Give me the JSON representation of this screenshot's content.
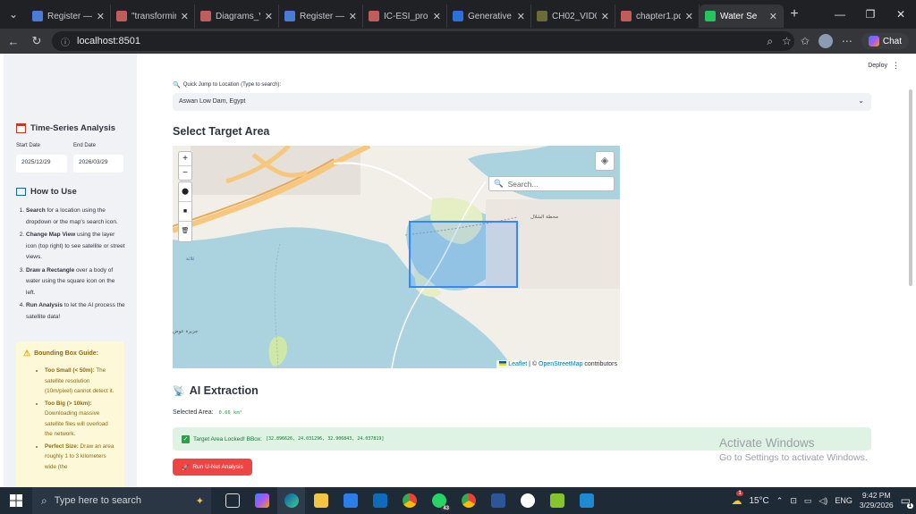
{
  "browser": {
    "tabs": [
      {
        "label": "Register — ",
        "color": "#4a7bd6"
      },
      {
        "label": "\"transformin",
        "color": "#c05c5c"
      },
      {
        "label": "Diagrams_V",
        "color": "#c05c5c"
      },
      {
        "label": "Register — ",
        "color": "#4a7bd6"
      },
      {
        "label": "IC-ESI_propo",
        "color": "#c05c5c"
      },
      {
        "label": "Generative ",
        "color": "#2a6fdb"
      },
      {
        "label": "CH02_VID01",
        "color": "#6b6b3a"
      },
      {
        "label": "chapter1.pdf",
        "color": "#c05c5c"
      },
      {
        "label": "Water Se",
        "color": "#22c55e"
      }
    ],
    "url": "localhost:8501",
    "chat_label": "Chat"
  },
  "sidebar": {
    "ts_title": "Time-Series Analysis",
    "start_label": "Start Date",
    "end_label": "End Date",
    "start_value": "2025/12/29",
    "end_value": "2026/03/29",
    "howto_title": "How to Use",
    "steps": [
      {
        "bold": "Search",
        "text": " for a location using the dropdown or the map's search icon."
      },
      {
        "bold": "Change Map View",
        "text": " using the layer icon (top right) to see satellite or street views."
      },
      {
        "bold": "Draw a Rectangle",
        "text": " over a body of water using the square icon on the left."
      },
      {
        "bold": "Run Analysis",
        "text": " to let the AI process the satellite data!"
      }
    ],
    "guide_title": "Bounding Box Guide:",
    "guide_items": [
      {
        "bold": "Too Small (< 50m):",
        "text": " The satellite resolution (10m/pixel) cannot detect it."
      },
      {
        "bold": "Too Big (> 10km):",
        "text": " Downloading massive satellite files will overload the network."
      },
      {
        "bold": "Perfect Size:",
        "text": " Draw an area roughly 1 to 3 kilometers wide (the"
      }
    ]
  },
  "main": {
    "deploy_label": "Deploy",
    "quick_jump_label": "Quick Jump to Location (Type to search):",
    "quick_jump_value": "Aswan Low Dam, Egypt",
    "select_title": "Select Target Area",
    "map": {
      "search_placeholder": "Search...",
      "attribution_leaflet": "Leaflet",
      "attribution_sep": " | © ",
      "attribution_osm": "OpenStreetMap",
      "attribution_tail": " contributors",
      "labels": [
        "محطة الشلال",
        "ثلاثة",
        "جزيرة عوض"
      ]
    },
    "ai_title": "AI Extraction",
    "selected_area_label": "Selected Area:",
    "selected_area_value": "0.66 km²",
    "locked_text": "Target Area Locked! BBox:",
    "bbox_value": "[32.896626, 24.031296, 32.906843, 24.037819]",
    "run_button": "Run U-Net Analysis",
    "watermark_title": "Activate Windows",
    "watermark_sub": "Go to Settings to activate Windows."
  },
  "taskbar": {
    "search_placeholder": "Type here to search",
    "whatsapp_badge": "43",
    "weather_badge": "1",
    "temperature": "15°C",
    "language": "ENG",
    "time": "9:42 PM",
    "date": "3/29/2026",
    "notif_badge": "1"
  }
}
